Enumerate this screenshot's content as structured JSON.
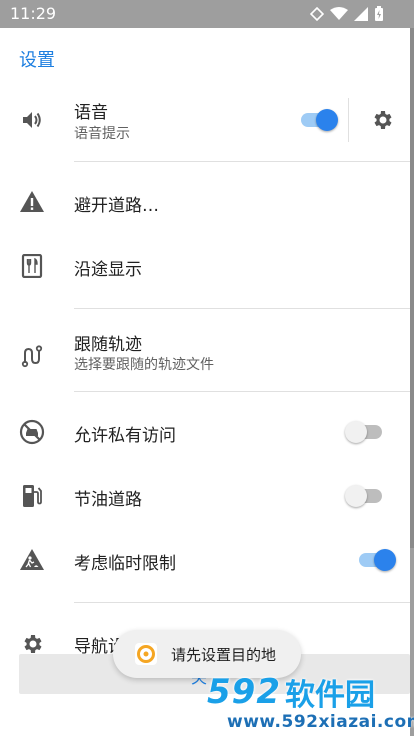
{
  "status_bar": {
    "time": "11:29"
  },
  "header": {
    "title": "设置"
  },
  "settings": {
    "voice": {
      "title": "语音",
      "subtitle": "语音提示",
      "enabled": true
    },
    "avoid_roads": {
      "title": "避开道路…"
    },
    "show_along_route": {
      "title": "沿途显示"
    },
    "follow_track": {
      "title": "跟随轨迹",
      "subtitle": "选择要跟随的轨迹文件"
    },
    "allow_private_access": {
      "title": "允许私有访问",
      "enabled": false
    },
    "fuel_efficient_roads": {
      "title": "节油道路",
      "enabled": false
    },
    "temporary_restrictions": {
      "title": "考虑临时限制",
      "enabled": true
    },
    "navigation_settings": {
      "title": "导航设"
    }
  },
  "bottom_button": {
    "label": "关"
  },
  "toast": {
    "message": "请先设置目的地"
  },
  "watermark": {
    "number": "592",
    "text": "软件园",
    "url": "www.592xiazai.com"
  },
  "colors": {
    "accent": "#2b82ec",
    "header_text": "#1e7fe0",
    "icon": "#555555"
  }
}
